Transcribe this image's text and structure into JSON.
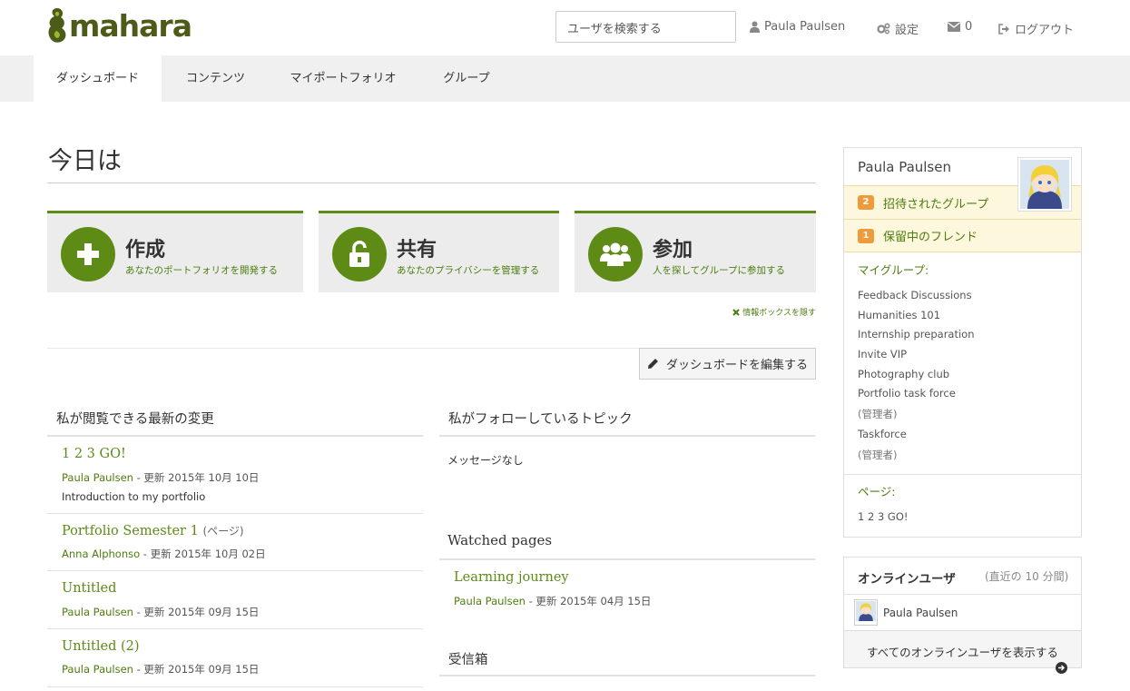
{
  "header": {
    "logo_text": "mahara",
    "search_placeholder": "ユーザを検索する",
    "user_name": "Paula Paulsen",
    "settings_label": "設定",
    "inbox_count": "0",
    "logout_label": "ログアウト"
  },
  "nav": {
    "items": [
      {
        "label": "ダッシュボード",
        "active": true
      },
      {
        "label": "コンテンツ"
      },
      {
        "label": "マイポートフォリオ"
      },
      {
        "label": "グループ"
      }
    ]
  },
  "main": {
    "title": "今日は",
    "cards": [
      {
        "title": "作成",
        "subtitle": "あなたのポートフォリオを開発する",
        "icon": "plus-icon"
      },
      {
        "title": "共有",
        "subtitle": "あなたのプライバシーを管理する",
        "icon": "unlock-icon"
      },
      {
        "title": "参加",
        "subtitle": "人を探してグループに参加する",
        "icon": "users-icon"
      }
    ],
    "hide_info_label": "情報ボックスを隠す",
    "edit_dashboard_label": "ダッシュボードを編集する",
    "latest_changes": {
      "heading": "私が閲覧できる最新の変更",
      "items": [
        {
          "title": "1 2 3 GO!",
          "kind": "",
          "author": "Paula Paulsen",
          "updated": " - 更新 2015年 10月 10日",
          "description": "Introduction to my portfolio"
        },
        {
          "title": "Portfolio Semester 1",
          "kind": "(ページ)",
          "author": "Anna Alphonso",
          "updated": " - 更新 2015年 10月 02日",
          "description": ""
        },
        {
          "title": "Untitled",
          "kind": "",
          "author": "Paula Paulsen",
          "updated": " - 更新 2015年 09月 15日",
          "description": ""
        },
        {
          "title": "Untitled (2)",
          "kind": "",
          "author": "Paula Paulsen",
          "updated": " - 更新 2015年 09月 15日",
          "description": ""
        }
      ]
    },
    "followed_topics": {
      "heading": "私がフォローしているトピック",
      "empty": "メッセージなし"
    },
    "watched_pages": {
      "heading": "Watched pages",
      "items": [
        {
          "title": "Learning journey",
          "author": "Paula Paulsen",
          "updated": " - 更新 2015年 04月 15日"
        }
      ]
    },
    "inbox": {
      "heading": "受信箱"
    }
  },
  "sidebar": {
    "profile_name": "Paula Paulsen",
    "notices": [
      {
        "count": "2",
        "label": "招待されたグループ"
      },
      {
        "count": "1",
        "label": "保留中のフレンド"
      }
    ],
    "my_groups_heading": "マイグループ:",
    "groups": [
      {
        "name": "Feedback Discussions",
        "note": ""
      },
      {
        "name": "Humanities 101",
        "note": ""
      },
      {
        "name": "Internship preparation",
        "note": ""
      },
      {
        "name": "Invite VIP",
        "note": ""
      },
      {
        "name": "Photography club",
        "note": ""
      },
      {
        "name": "Portfolio task force",
        "note": "(管理者)"
      },
      {
        "name": "Taskforce",
        "note": "(管理者)"
      }
    ],
    "pages_heading": "ページ:",
    "pages": [
      "1 2 3 GO!"
    ],
    "online": {
      "title": "オンラインユーザ",
      "recent": "(直近の 10 分間)",
      "users": [
        "Paula Paulsen"
      ],
      "show_all_label": "すべてのオンラインユーザを表示する"
    }
  },
  "colors": {
    "brand_green": "#5d8b16",
    "link_green": "#4d7d0e",
    "badge_orange": "#ee9b3b",
    "notice_bg": "#fcf7dd"
  }
}
